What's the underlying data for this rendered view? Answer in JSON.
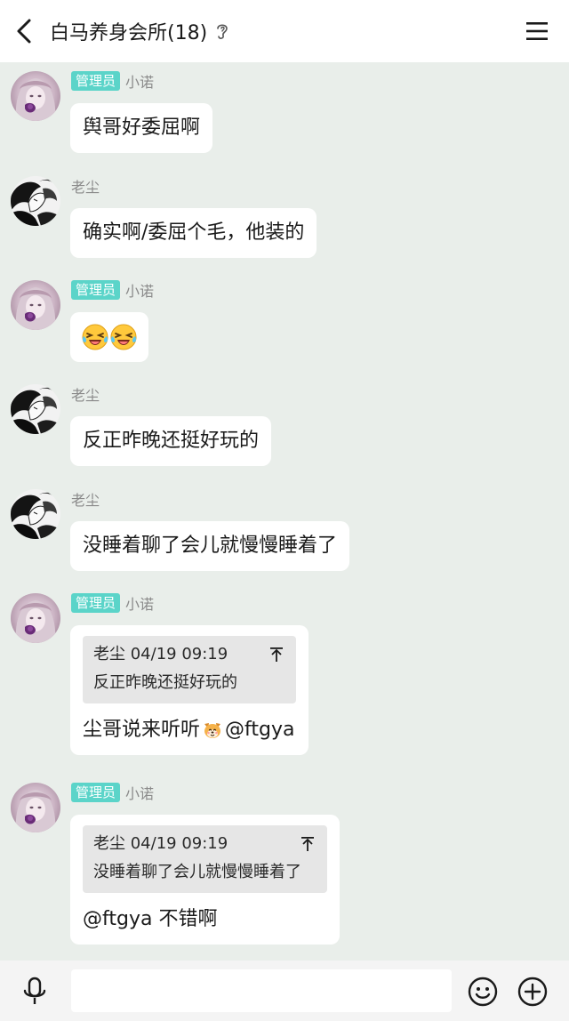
{
  "header": {
    "title": "白马养身会所(18)"
  },
  "labels": {
    "admin_badge": "管理员"
  },
  "messages": [
    {
      "sender": "小诺",
      "text": "舆哥好委屈啊"
    },
    {
      "sender": "老尘",
      "text": "确实啊/委屈个毛，他装的"
    },
    {
      "sender": "小诺",
      "emojis": [
        "grinning-tears-emoji",
        "grinning-tears-emoji"
      ]
    },
    {
      "sender": "老尘",
      "text": "反正昨晚还挺好玩的"
    },
    {
      "sender": "老尘",
      "text": "没睡着聊了会儿就慢慢睡着了"
    },
    {
      "sender": "小诺",
      "quote": {
        "author": "老尘",
        "time": "04/19 09:19",
        "text": "反正昨晚还挺好玩的"
      },
      "text_before": "尘哥说来听听",
      "text_after": "@ftgya"
    },
    {
      "sender": "小诺",
      "quote": {
        "author": "老尘",
        "time": "04/19 09:19",
        "text": "没睡着聊了会儿就慢慢睡着了"
      },
      "text": "@ftgya 不错啊"
    }
  ],
  "composer": {
    "placeholder": ""
  },
  "colors": {
    "chat_bg": "#e9eeea",
    "badge": "#5bd4c9",
    "bubble": "#ffffff",
    "quote_bg": "#e6e6e6"
  }
}
